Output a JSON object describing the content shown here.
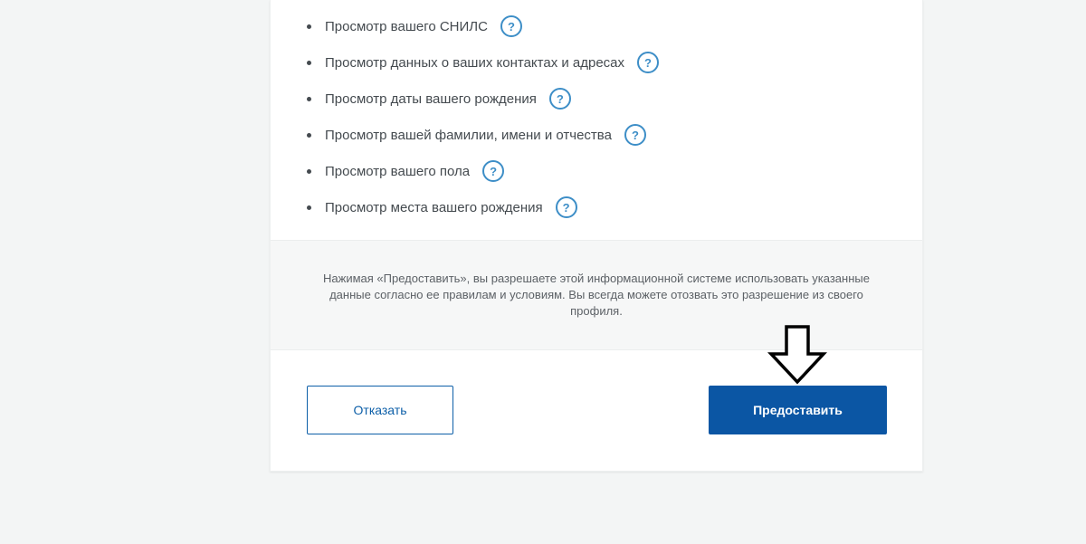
{
  "permissions": [
    {
      "label": "Просмотр вашего СНИЛС"
    },
    {
      "label": "Просмотр данных о ваших контактах и адресах"
    },
    {
      "label": "Просмотр даты вашего рождения"
    },
    {
      "label": "Просмотр вашей фамилии, имени и отчества"
    },
    {
      "label": "Просмотр вашего пола"
    },
    {
      "label": "Просмотр места вашего рождения"
    }
  ],
  "help_glyph": "?",
  "consent": {
    "text": "Нажимая «Предоставить», вы разрешаете этой информационной системе использовать указанные данные согласно ее правилам и условиям. Вы всегда можете отозвать это разрешение из своего профиля."
  },
  "actions": {
    "decline_label": "Отказать",
    "grant_label": "Предоставить"
  },
  "colors": {
    "accent": "#0b56a4",
    "help_icon": "#3d8ec7"
  },
  "annotation": {
    "icon": "down-arrow-icon"
  }
}
